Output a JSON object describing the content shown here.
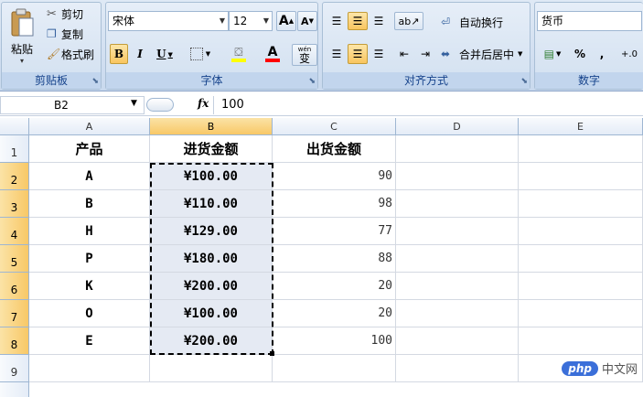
{
  "ribbon": {
    "clipboard": {
      "paste": "粘贴",
      "cut": "剪切",
      "copy": "复制",
      "format_painter": "格式刷",
      "group_label": "剪贴板"
    },
    "font": {
      "font_name": "宋体",
      "font_size": "12",
      "grow": "A",
      "shrink": "A",
      "bold": "B",
      "italic": "I",
      "underline": "U",
      "font_color_glyph": "A",
      "phonetic": "wén",
      "phonetic_char": "变",
      "group_label": "字体",
      "fill_color": "#ffff00",
      "font_color": "#ff0000"
    },
    "alignment": {
      "wrap_text": "自动换行",
      "merge_center": "合并后居中",
      "group_label": "对齐方式"
    },
    "number": {
      "format": "货币",
      "percent": "%",
      "comma": ",",
      "decimals": "+.0",
      "group_label": "数字"
    }
  },
  "formula_bar": {
    "name_box": "B2",
    "fx": "fx",
    "value": "100"
  },
  "columns": [
    "A",
    "B",
    "C",
    "D",
    "E"
  ],
  "rows": [
    "1",
    "2",
    "3",
    "4",
    "5",
    "6",
    "7",
    "8",
    "9"
  ],
  "table": {
    "headers": [
      "产品",
      "进货金额",
      "出货金额"
    ],
    "data": [
      [
        "A",
        "¥100.00",
        "90"
      ],
      [
        "B",
        "¥110.00",
        "98"
      ],
      [
        "H",
        "¥129.00",
        "77"
      ],
      [
        "P",
        "¥180.00",
        "88"
      ],
      [
        "K",
        "¥200.00",
        "20"
      ],
      [
        "O",
        "¥100.00",
        "20"
      ],
      [
        "E",
        "¥200.00",
        "100"
      ]
    ]
  },
  "watermark": {
    "logo": "php",
    "text": "中文网"
  }
}
